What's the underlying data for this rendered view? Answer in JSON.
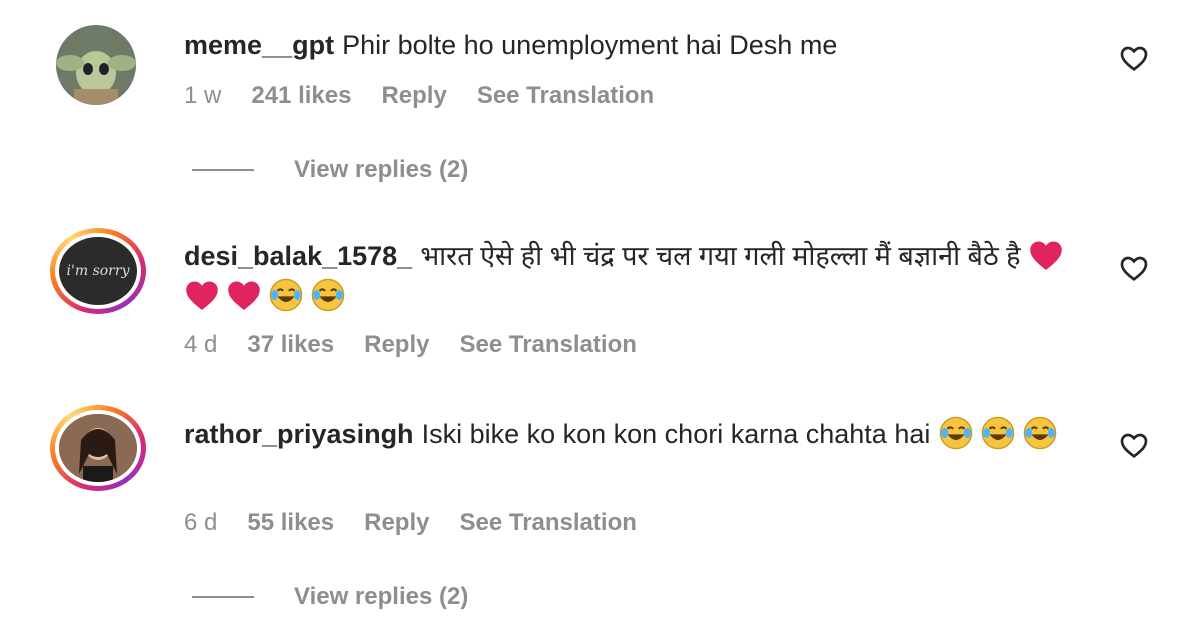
{
  "comments": [
    {
      "username": "meme__gpt",
      "text": "Phir bolte ho unemployment hai Desh me",
      "emojis": [],
      "age": "1 w",
      "likes": "241 likes",
      "reply_label": "Reply",
      "translate_label": "See Translation",
      "view_replies": "View replies (2)"
    },
    {
      "username": "desi_balak_1578_",
      "text": "भारत ऐसे ही भी चंद्र पर चल गया गली मोहल्ला मैं बज्ञानी बैठे है",
      "emojis": [
        "red-heart",
        "red-heart",
        "red-heart",
        "laugh-cry",
        "laugh-cry"
      ],
      "avatar_text": "i'm sorry",
      "age": "4 d",
      "likes": "37 likes",
      "reply_label": "Reply",
      "translate_label": "See Translation"
    },
    {
      "username": "rathor_priyasingh",
      "text": "Iski bike ko kon kon chori karna chahta hai",
      "emojis": [
        "laugh-cry",
        "laugh-cry",
        "laugh-cry"
      ],
      "age": "6 d",
      "likes": "55 likes",
      "reply_label": "Reply",
      "translate_label": "See Translation",
      "view_replies": "View replies (2)"
    }
  ],
  "colors": {
    "text": "#262626",
    "secondary": "#8e8e8e",
    "heart_emoji": "#e0245e",
    "laugh_emoji": "#f5c542"
  }
}
